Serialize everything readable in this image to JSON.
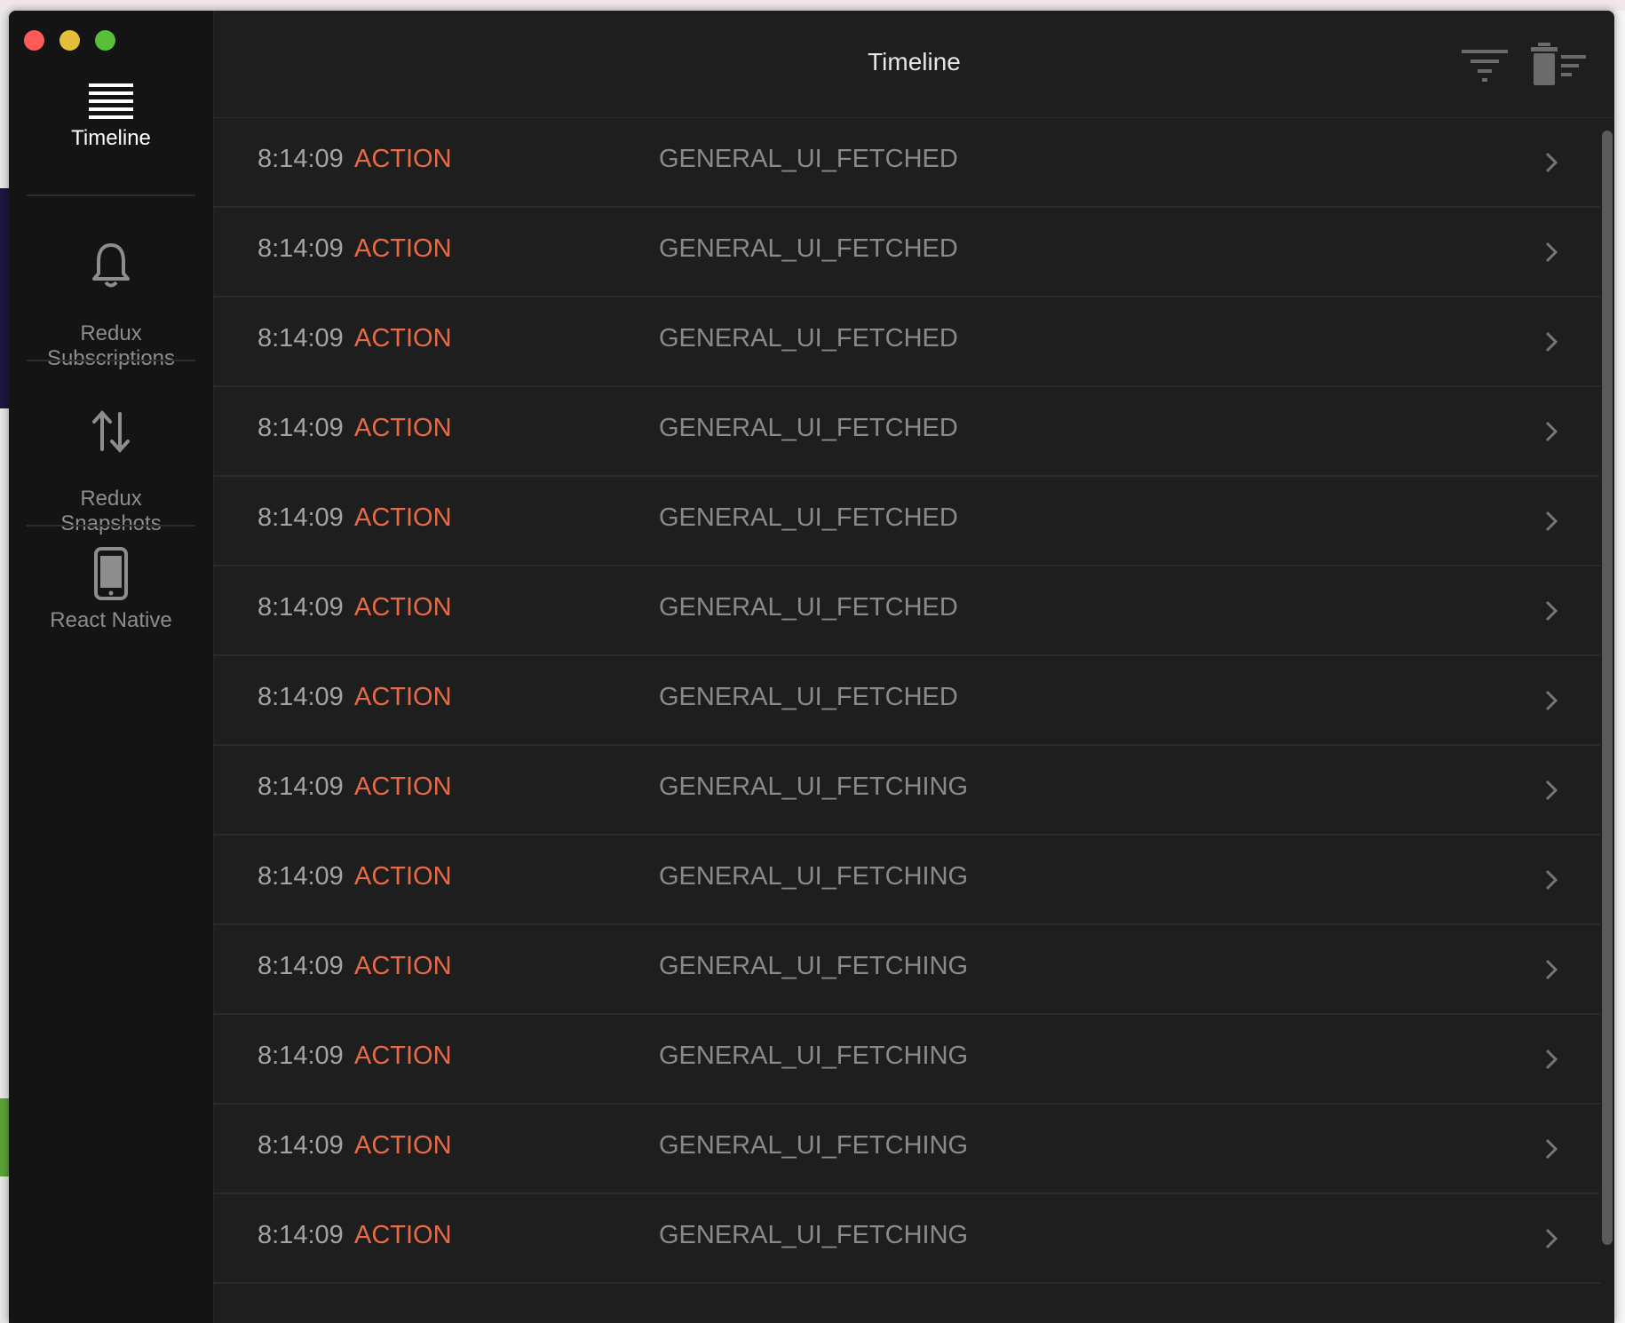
{
  "window": {
    "traffic_lights": [
      "close",
      "minimize",
      "zoom"
    ]
  },
  "sidebar": {
    "items": [
      {
        "label": "Timeline",
        "icon": "list-icon",
        "active": true
      },
      {
        "label": "Redux\nSubscriptions",
        "icon": "bell-icon",
        "active": false
      },
      {
        "label": "Redux\nSnapshots",
        "icon": "arrows-up-down-icon",
        "active": false
      },
      {
        "label": "React Native",
        "icon": "phone-icon",
        "active": false
      }
    ]
  },
  "header": {
    "title": "Timeline",
    "filter_icon": "filter-icon",
    "clear_icon": "trash-icon"
  },
  "timeline": {
    "rows": [
      {
        "time": "8:14:09",
        "type": "ACTION",
        "name": "GENERAL_UI_FETCHED"
      },
      {
        "time": "8:14:09",
        "type": "ACTION",
        "name": "GENERAL_UI_FETCHED"
      },
      {
        "time": "8:14:09",
        "type": "ACTION",
        "name": "GENERAL_UI_FETCHED"
      },
      {
        "time": "8:14:09",
        "type": "ACTION",
        "name": "GENERAL_UI_FETCHED"
      },
      {
        "time": "8:14:09",
        "type": "ACTION",
        "name": "GENERAL_UI_FETCHED"
      },
      {
        "time": "8:14:09",
        "type": "ACTION",
        "name": "GENERAL_UI_FETCHED"
      },
      {
        "time": "8:14:09",
        "type": "ACTION",
        "name": "GENERAL_UI_FETCHED"
      },
      {
        "time": "8:14:09",
        "type": "ACTION",
        "name": "GENERAL_UI_FETCHING"
      },
      {
        "time": "8:14:09",
        "type": "ACTION",
        "name": "GENERAL_UI_FETCHING"
      },
      {
        "time": "8:14:09",
        "type": "ACTION",
        "name": "GENERAL_UI_FETCHING"
      },
      {
        "time": "8:14:09",
        "type": "ACTION",
        "name": "GENERAL_UI_FETCHING"
      },
      {
        "time": "8:14:09",
        "type": "ACTION",
        "name": "GENERAL_UI_FETCHING"
      },
      {
        "time": "8:14:09",
        "type": "ACTION",
        "name": "GENERAL_UI_FETCHING"
      }
    ]
  },
  "colors": {
    "accent_action": "#e96a45",
    "window_bg": "#1e1e1e",
    "sidebar_bg": "#141414"
  }
}
